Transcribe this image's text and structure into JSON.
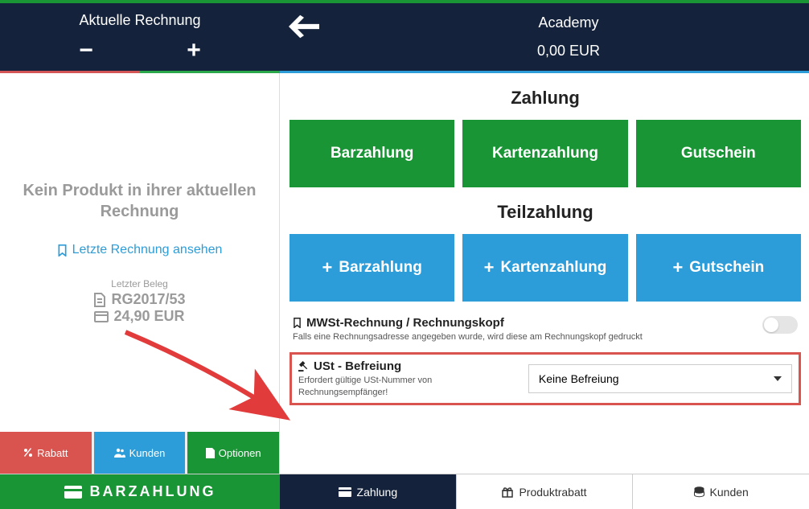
{
  "header": {
    "left_title": "Aktuelle Rechnung",
    "minus": "−",
    "plus": "+",
    "location": "Academy",
    "amount": "0,00 EUR"
  },
  "sidebar": {
    "no_product": "Kein Produkt in ihrer aktuellen Rechnung",
    "last_invoice_link": "Letzte Rechnung ansehen",
    "last_receipt_label": "Letzter Beleg",
    "receipt_no": "RG2017/53",
    "receipt_amount": "24,90 EUR",
    "buttons": {
      "discount": "Rabatt",
      "customers": "Kunden",
      "options": "Optionen"
    }
  },
  "main": {
    "payment_title": "Zahlung",
    "full": {
      "cash": "Barzahlung",
      "card": "Kartenzahlung",
      "voucher": "Gutschein"
    },
    "partial_title": "Teilzahlung",
    "partial": {
      "cash": "Barzahlung",
      "card": "Kartenzahlung",
      "voucher": "Gutschein"
    },
    "vat_invoice": {
      "title": "MWSt-Rechnung / Rechnungskopf",
      "sub": "Falls eine Rechnungsadresse angegeben wurde, wird diese am Rechnungskopf gedruckt"
    },
    "vat_exempt": {
      "title": "USt - Befreiung",
      "sub": "Erfordert gültige USt-Nummer von Rechnungsempfänger!",
      "selected": "Keine Befreiung"
    }
  },
  "bottom": {
    "cash": "BARZAHLUNG",
    "tabs": {
      "payment": "Zahlung",
      "product_discount": "Produktrabatt",
      "customers": "Kunden"
    }
  }
}
